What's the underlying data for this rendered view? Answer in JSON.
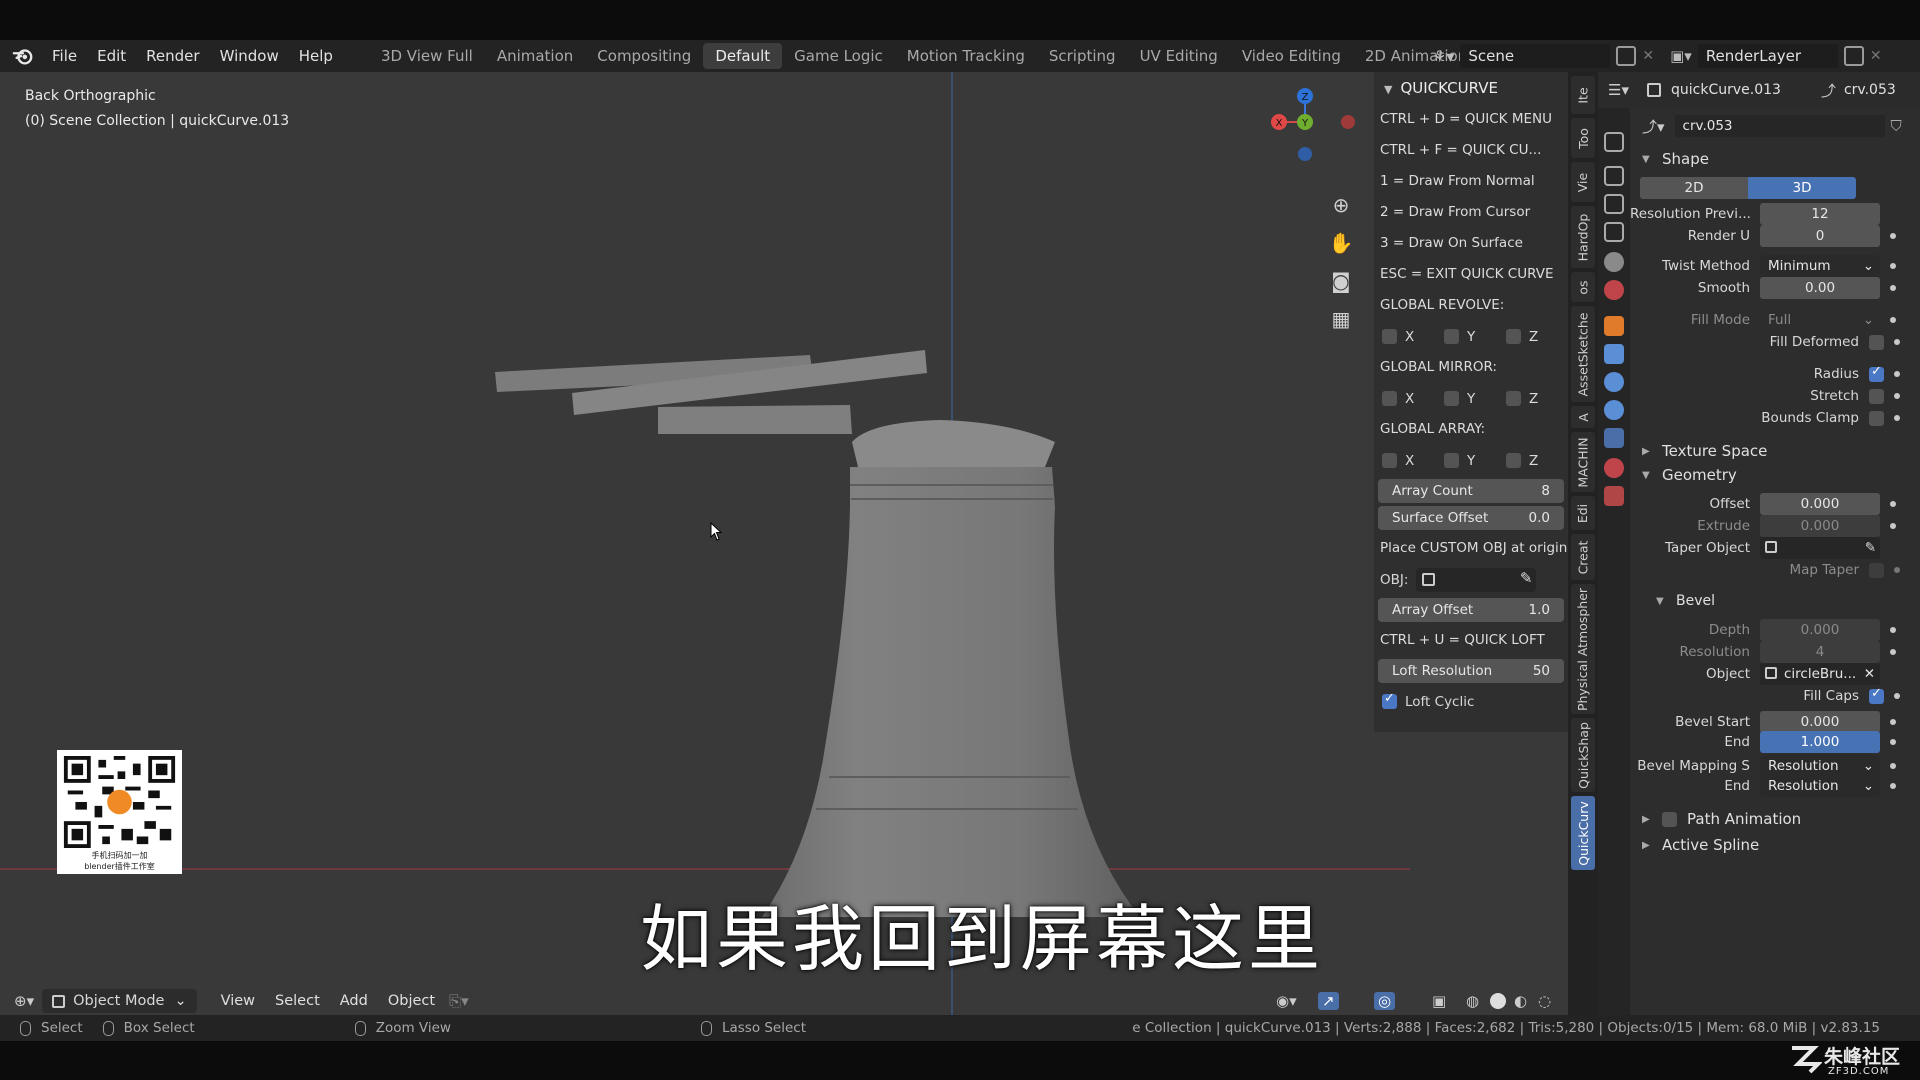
{
  "topbar": {
    "menus": [
      "File",
      "Edit",
      "Render",
      "Window",
      "Help"
    ],
    "workspaces": [
      "3D View Full",
      "Animation",
      "Compositing",
      "Default",
      "Game Logic",
      "Motion Tracking",
      "Scripting",
      "UV Editing",
      "Video Editing",
      "2D Animation"
    ],
    "active_workspace": "Default",
    "add_tab": "+",
    "scene": "Scene",
    "view_layer": "RenderLayer"
  },
  "viewport": {
    "view_name": "Back Orthographic",
    "collection_info": "(0) Scene Collection | quickCurve.013",
    "gizmo_axes": {
      "z": "Z",
      "x": "X",
      "y": "Y"
    },
    "subtitle": "如果我回到屏幕这里",
    "qr_caption_line1": "手机扫码加一加",
    "qr_caption_line2": "blender插件工作室"
  },
  "quickcurve": {
    "title": "QUICKCURVE",
    "hotkeys": [
      "CTRL + D = QUICK MENU",
      "CTRL + F = QUICK CU...",
      "1 = Draw From Normal",
      "2 = Draw From Cursor",
      "3 = Draw On Surface",
      "ESC = EXIT QUICK CURVE"
    ],
    "global_revolve": "GLOBAL REVOLVE:",
    "global_mirror": "GLOBAL MIRROR:",
    "global_array": "GLOBAL ARRAY:",
    "axes": [
      "X",
      "Y",
      "Z"
    ],
    "array_count_label": "Array Count",
    "array_count": "8",
    "surface_offset_label": "Surface Offset",
    "surface_offset": "0.0",
    "custom_obj_text": "Place CUSTOM OBJ at origin",
    "obj_label": "OBJ:",
    "array_offset_label": "Array Offset",
    "array_offset": "1.0",
    "quick_loft": "CTRL + U = QUICK LOFT",
    "loft_resolution_label": "Loft Resolution",
    "loft_resolution": "50",
    "loft_cyclic_label": "Loft Cyclic",
    "loft_cyclic": true
  },
  "side_tabs": [
    "Ite",
    "Too",
    "Vie",
    "HardOp",
    "os",
    "AssetSketche",
    "A",
    "MACHIN",
    "Edi",
    "Creat",
    "Physical Atmospher",
    "QuickShap",
    "QuickCurv"
  ],
  "active_side_tab": "QuickCurv",
  "properties": {
    "object_name": "quickCurve.013",
    "data_name": "crv.053",
    "datablock": "crv.053",
    "shape_section": "Shape",
    "dim_2d": "2D",
    "dim_3d": "3D",
    "dimension_selected": "3D",
    "resolution_preview_label": "Resolution Previ...",
    "resolution_preview": "12",
    "render_u_label": "Render U",
    "render_u": "0",
    "twist_method_label": "Twist Method",
    "twist_method": "Minimum",
    "smooth_label": "Smooth",
    "smooth": "0.00",
    "fill_mode_label": "Fill Mode",
    "fill_mode": "Full",
    "fill_deformed_label": "Fill Deformed",
    "radius_label": "Radius",
    "stretch_label": "Stretch",
    "bounds_clamp_label": "Bounds Clamp",
    "texture_space_section": "Texture Space",
    "geometry_section": "Geometry",
    "offset_label": "Offset",
    "offset": "0.000",
    "extrude_label": "Extrude",
    "extrude": "0.000",
    "taper_object_label": "Taper Object",
    "map_taper_label": "Map Taper",
    "bevel_section": "Bevel",
    "depth_label": "Depth",
    "depth": "0.000",
    "resolution_label": "Resolution",
    "resolution": "4",
    "object_label": "Object",
    "bevel_object": "circleBru...",
    "fill_caps_label": "Fill Caps",
    "bevel_start_label": "Bevel Start",
    "bevel_start": "0.000",
    "end_label": "End",
    "bevel_end": "1.000",
    "bevel_mapping_label": "Bevel Mapping S",
    "bevel_mapping_start": "Resolution",
    "bevel_mapping_end_label": "End",
    "bevel_mapping_end": "Resolution",
    "path_animation_section": "Path Animation",
    "active_spline_section": "Active Spline"
  },
  "toolbar": {
    "mode": "Object Mode",
    "view": "View",
    "select": "Select",
    "add": "Add",
    "object": "Object"
  },
  "statusbar": {
    "select": "Select",
    "box_select": "Box Select",
    "zoom_view": "Zoom View",
    "lasso_select": "Lasso Select",
    "stats": "e Collection | quickCurve.013 | Verts:2,888 | Faces:2,682 | Tris:5,280 | Objects:0/15 | Mem: 68.0 MiB | v2.83.15"
  },
  "watermark": {
    "main": "朱峰社区",
    "sub": "ZF3D.COM"
  },
  "colors": {
    "accent": "#4772b3",
    "viewport_bg": "#393939",
    "panel_bg": "#2d2d2d"
  }
}
